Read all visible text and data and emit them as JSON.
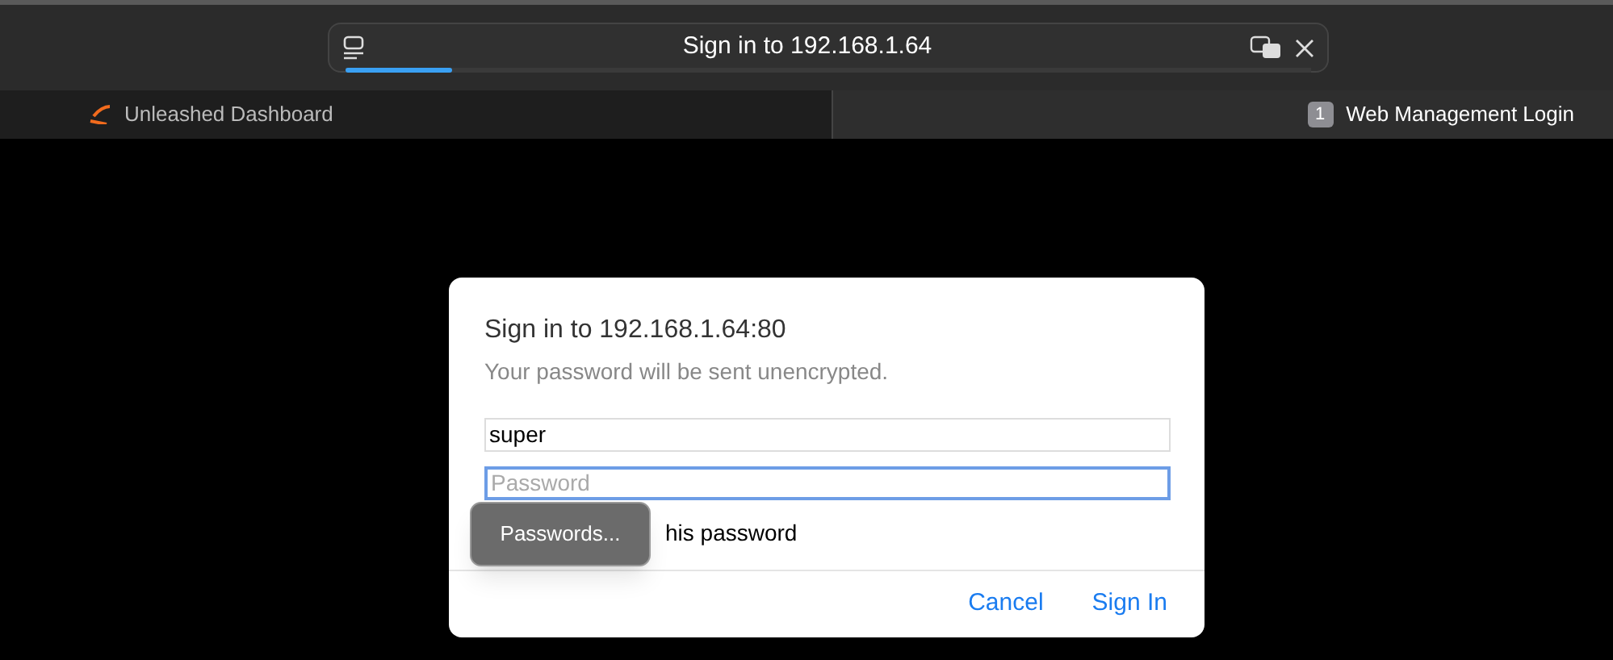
{
  "address_bar": {
    "title": "Sign in to 192.168.1.64",
    "loading": {
      "level": 0.11
    }
  },
  "tabs": [
    {
      "label": "Unleashed Dashboard",
      "selected": false
    },
    {
      "label": "Web Management Login",
      "badge": "1",
      "selected": true
    }
  ],
  "dialog": {
    "title": "Sign in to 192.168.1.64:80",
    "subtitle": "Your password will be sent unencrypted.",
    "username": {
      "value": "super"
    },
    "password": {
      "placeholder": "Password",
      "focused": true
    },
    "remember_label": "his password",
    "popup": {
      "label": "Passwords..."
    },
    "buttons": [
      "Cancel",
      "Sign In"
    ]
  }
}
